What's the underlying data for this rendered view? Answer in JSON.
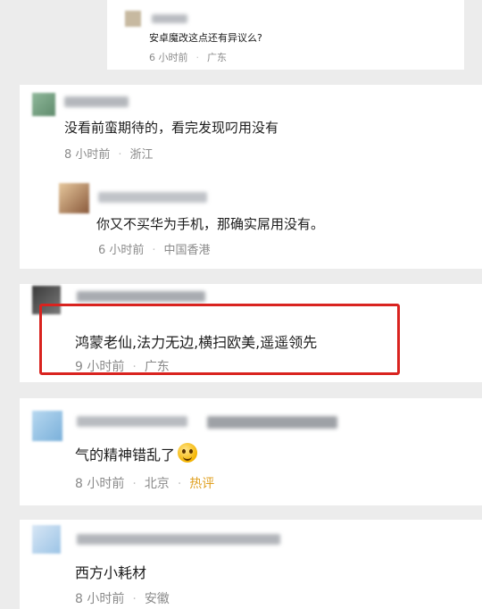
{
  "comments": [
    {
      "text": "安卓魔改这点还有异议么?",
      "time": "6 小时前",
      "location": "广东"
    },
    {
      "text": "没看前蛮期待的，看完发现叼用没有",
      "time": "8 小时前",
      "location": "浙江"
    },
    {
      "text": "你又不买华为手机，那确实屌用没有。",
      "time": "6 小时前",
      "location": "中国香港"
    },
    {
      "text": "鸿蒙老仙,法力无边,横扫欧美,遥遥领先",
      "time": "9 小时前",
      "location": "广东"
    },
    {
      "text": "气的精神错乱了",
      "time": "8 小时前",
      "location": "北京",
      "badge": "热评",
      "emoji_icon": "grinning-face-icon"
    },
    {
      "text": "西方小耗材",
      "time": "8 小时前",
      "location": "安徽"
    }
  ],
  "colors": {
    "highlight_border": "#d9231f",
    "hot_badge": "#e0a020",
    "meta_text": "#8a8a8a"
  }
}
